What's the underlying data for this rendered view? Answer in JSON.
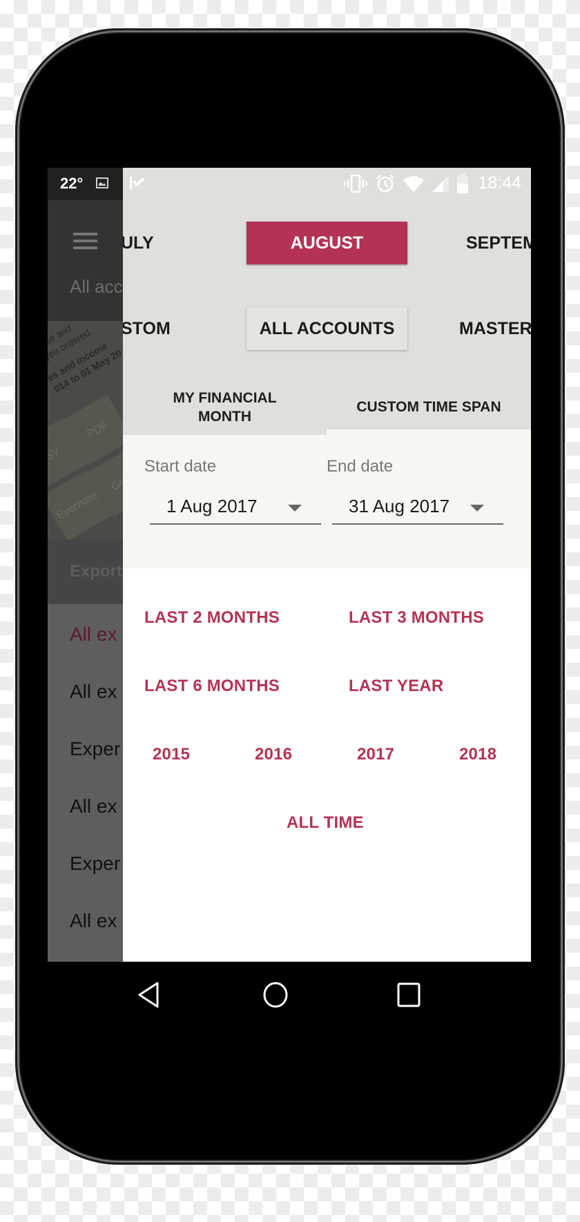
{
  "status_bar": {
    "temperature": "22°",
    "time": "18:44",
    "icons": [
      "image-icon",
      "app-check-icon",
      "vibrate-icon",
      "alarm-icon",
      "wifi-icon",
      "signal-icon",
      "battery-icon"
    ]
  },
  "background_drawer": {
    "header_subtitle": "All acc",
    "illustration": {
      "lines": [
        "pense and",
        "s you ordered.",
        "es and income",
        "014 to 01 May 20"
      ],
      "tiles": [
        "SV",
        "PDF",
        "Evernote",
        "Go D"
      ]
    },
    "section_header": "Export",
    "items": [
      {
        "label": "All ex",
        "active": true
      },
      {
        "label": "All ex",
        "active": false
      },
      {
        "label": "Exper",
        "active": false
      },
      {
        "label": "All ex",
        "active": false
      },
      {
        "label": "Exper",
        "active": false
      },
      {
        "label": "All ex",
        "active": false
      }
    ]
  },
  "month_selector": {
    "prev": "ULY",
    "selected": "AUGUST",
    "next": "SEPTEM"
  },
  "account_selector": {
    "prev": "STOM",
    "selected": "ALL ACCOUNTS",
    "next": "MASTER"
  },
  "tabs": [
    {
      "label": "MY FINANCIAL MONTH",
      "active": false
    },
    {
      "label": "CUSTOM TIME SPAN",
      "active": true
    }
  ],
  "date_range": {
    "start_label": "Start date",
    "start_value": "1 Aug 2017",
    "end_label": "End date",
    "end_value": "31 Aug 2017"
  },
  "quick_ranges": {
    "last_2_months": "LAST 2 MONTHS",
    "last_3_months": "LAST 3 MONTHS",
    "last_6_months": "LAST 6 MONTHS",
    "last_year": "LAST YEAR",
    "years": [
      "2015",
      "2016",
      "2017",
      "2018"
    ],
    "all_time": "ALL TIME"
  },
  "nav_bar": {
    "buttons": [
      "back-icon",
      "home-icon",
      "recents-icon"
    ]
  },
  "colors": {
    "accent": "#b43354",
    "sheet_top": "#dfe0dc",
    "date_area": "#f7f7f2"
  }
}
